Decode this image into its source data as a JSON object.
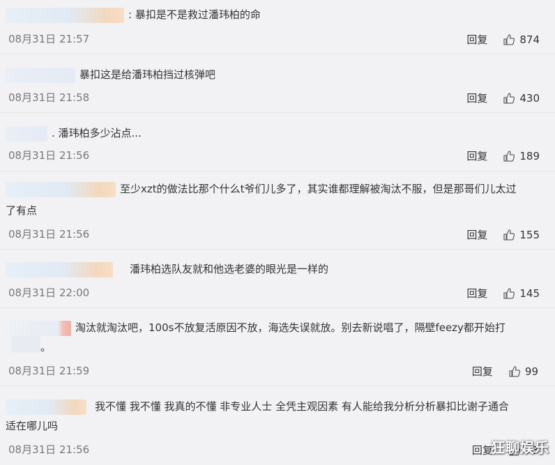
{
  "ui": {
    "reply_label": "回复"
  },
  "comments": [
    {
      "text": ": 暴扣是不是救过潘玮柏的命",
      "time": "08月31日 21:57",
      "likes": "874"
    },
    {
      "text": "暴扣这是给潘玮柏挡过核弹吧",
      "time": "08月31日 21:58",
      "likes": "430"
    },
    {
      "text": ". 潘玮柏多少沾点...",
      "time": "08月31日 21:56",
      "likes": "189"
    },
    {
      "text_line1": "至少xzt的做法比那个什么t爷们儿多了，其实谁都理解被淘汰不服，但是那哥们儿太过",
      "text_line2": "了有点",
      "time": "08月31日 21:56",
      "likes": "155"
    },
    {
      "text": "潘玮柏选队友就和他选老婆的眼光是一样的",
      "time": "08月31日 22:00",
      "likes": "145"
    },
    {
      "text_line1": "淘汰就淘汰吧，100s不放复活原因不放，海选失误就放。别去新说唱了，隔壁feezy都开始打",
      "text_line2": "。",
      "time": "08月31日 21:59",
      "likes": "99"
    },
    {
      "text_line1": "我不懂 我不懂 我真的不懂 非专业人士 全凭主观因素 有人能给我分析分析暴扣比谢子通合",
      "text_line2": "适在哪儿吗",
      "time": "08月31日 21:56",
      "likes": "73"
    }
  ],
  "watermark": "狂聊娱乐"
}
